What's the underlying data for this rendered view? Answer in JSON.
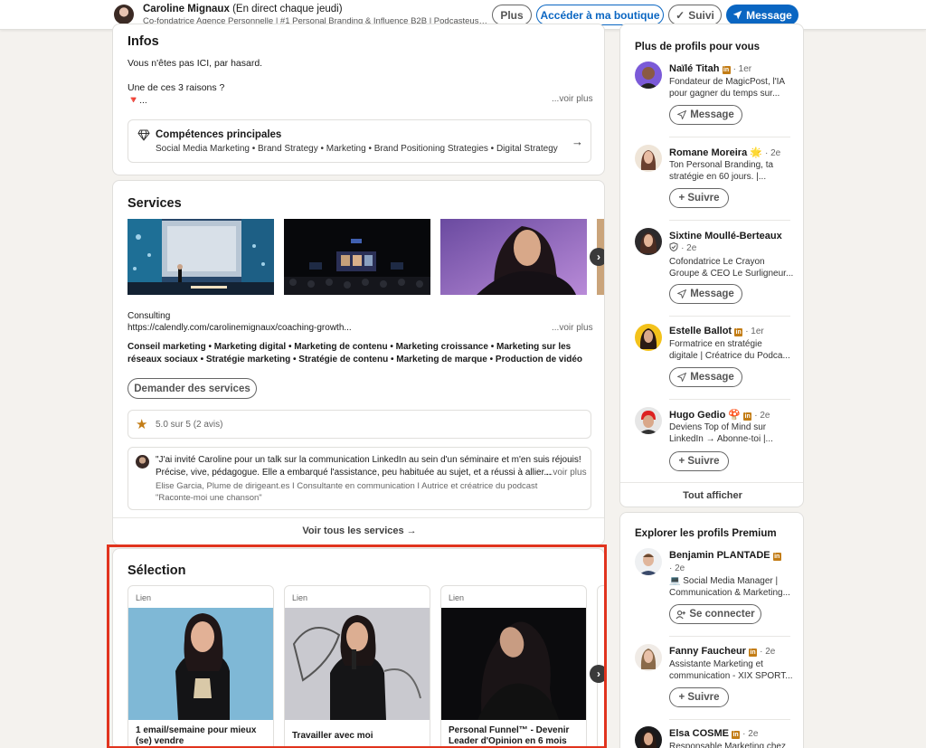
{
  "topbar": {
    "name": "Caroline Mignaux",
    "status": "(En direct chaque jeudi)",
    "headline": "Co-fondatrice Agence Personnelle | #1 Personal Branding & Influence B2B | Podcasteuse \"Marketin...",
    "btn_more": "Plus",
    "btn_shop": "Accéder à ma boutique",
    "btn_following": "Suivi",
    "btn_message": "Message"
  },
  "infos": {
    "title": "Infos",
    "line1": "Vous n'êtes pas ICI, par hasard.",
    "line2": "Une de ces 3 raisons ?",
    "line3": "🔻...",
    "see_more": "...voir plus",
    "skills_title": "Compétences principales",
    "skills_list": "Social Media Marketing • Brand Strategy • Marketing • Brand Positioning Strategies • Digital Strategy"
  },
  "services": {
    "title": "Services",
    "category": "Consulting",
    "link": "https://calendly.com/carolinemignaux/coaching-growth...",
    "see_more": "...voir plus",
    "list_line1": "Conseil marketing • Marketing digital • Marketing de contenu • Marketing croissance • Marketing sur les",
    "list_line2": "réseaux sociaux • Stratégie marketing • Stratégie de contenu • Marketing de marque • Production de vidéo",
    "request_button": "Demander des services",
    "rating": "5.0 sur 5 (2 avis)",
    "review_line1": "\"J'ai invité Caroline pour un talk sur la communication LinkedIn au sein d'un séminaire et m'en suis réjouis!",
    "review_line2": "Précise, vive, pédagogue. Elle a embarqué l'assistance, peu habituée au sujet, et a réussi à allier...",
    "review_see_more": "...voir plus",
    "reviewer_line1": "Elise Garcia, Plume de dirigeant.es I Consultante en communication I Autrice et créatrice du podcast",
    "reviewer_line2": "\"Raconte-moi une chanson\"",
    "see_all": "Voir tous les services →"
  },
  "selection": {
    "title": "Sélection",
    "items": [
      {
        "tag": "Lien",
        "title_line1": "1 email/semaine pour mieux",
        "title_line2": "(se) vendre"
      },
      {
        "tag": "Lien",
        "title_line1": "Travailler avec moi",
        "title_line2": ""
      },
      {
        "tag": "Lien",
        "title_line1": "Personal Funnel™ - Devenir",
        "title_line2": "Leader d'Opinion en 6 mois"
      }
    ]
  },
  "profiles": {
    "title": "Plus de profils pour vous",
    "show_all": "Tout afficher",
    "items": [
      {
        "name": "Naïlé Titah",
        "degree": "· 1er",
        "desc_line1": "Fondateur de MagicPost, l'IA",
        "desc_line2": "pour gagner du temps sur...",
        "action": "Message"
      },
      {
        "name": "Romane Moreira 🌟",
        "degree": "· 2e",
        "desc_line1": "Ton Personal Branding, ta",
        "desc_line2": "stratégie en 60 jours. |...",
        "action": "+ Suivre"
      },
      {
        "name": "Sixtine Moullé-Berteaux",
        "degree": "· 2e",
        "desc_line1": "Cofondatrice Le Crayon",
        "desc_line2": "Groupe & CEO Le Surligneur...",
        "action": "Message"
      },
      {
        "name": "Estelle Ballot",
        "degree": "· 1er",
        "desc_line1": "Formatrice en stratégie",
        "desc_line2": "digitale | Créatrice du Podca...",
        "action": "Message"
      },
      {
        "name": "Hugo Gedio 🍄",
        "degree": "· 2e",
        "desc_line1": "Deviens Top of Mind sur",
        "desc_line2": "LinkedIn → Abonne-toi |...",
        "action": "+ Suivre"
      }
    ]
  },
  "premium": {
    "title": "Explorer les profils Premium",
    "items": [
      {
        "name": "Benjamin PLANTADE",
        "degree": "· 2e",
        "desc_line1": "💻 Social Media Manager |",
        "desc_line2": "Communication & Marketing...",
        "action": "Se connecter"
      },
      {
        "name": "Fanny Faucheur",
        "degree": "· 2e",
        "desc_line1": "Assistante Marketing et",
        "desc_line2": "communication - XIX SPORT...",
        "action": "+ Suivre"
      },
      {
        "name": "Elsa COSME",
        "degree": "· 2e",
        "desc_line1": "Responsable Marketing chez",
        "desc_line2": "",
        "action": ""
      }
    ]
  }
}
